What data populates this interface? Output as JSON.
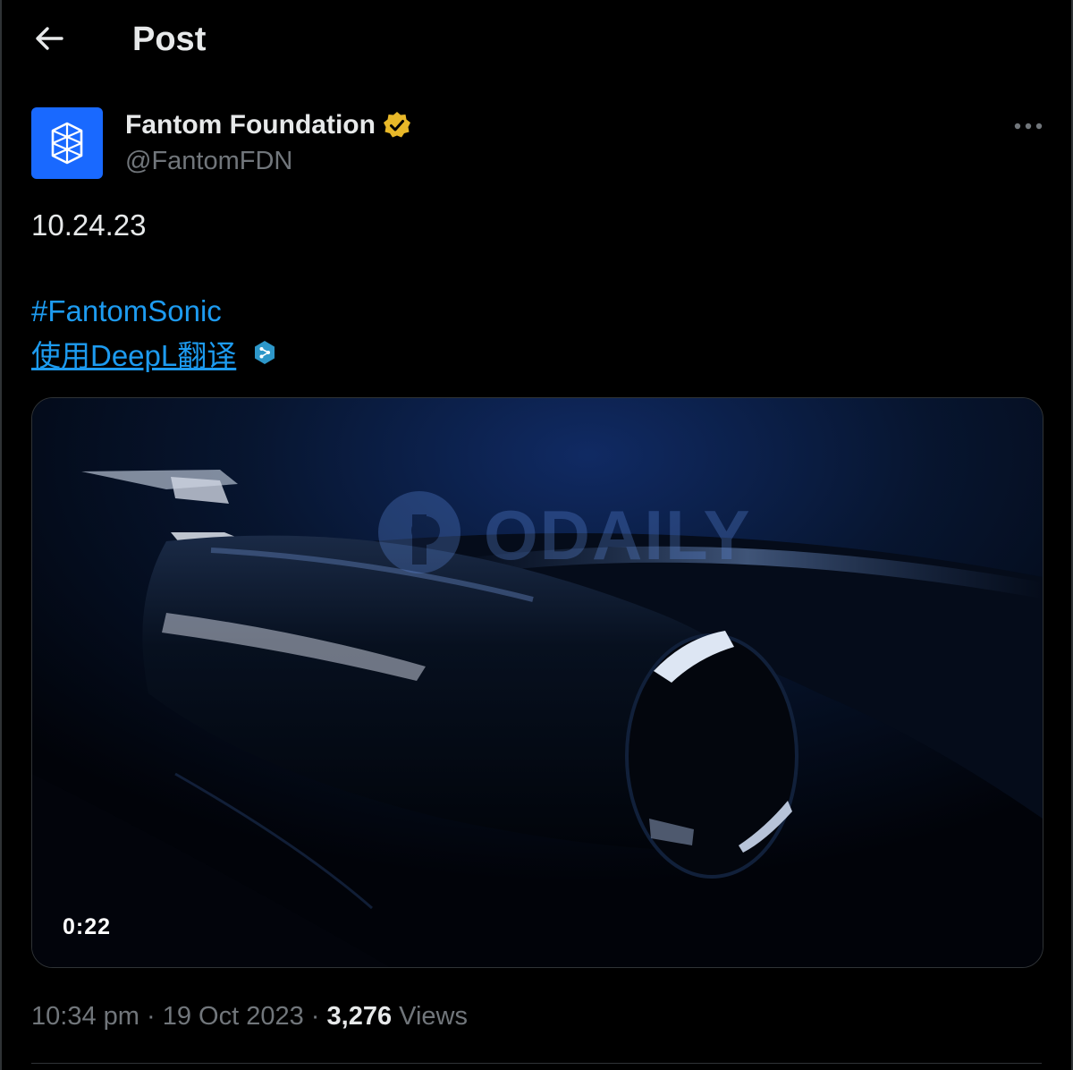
{
  "header": {
    "title": "Post",
    "back_icon": "arrow-left-icon"
  },
  "author": {
    "name": "Fantom Foundation",
    "handle": "@FantomFDN",
    "avatar_icon": "fantom-logo-icon",
    "verified_icon": "verified-badge-icon",
    "avatar_color": "#1969ff",
    "verified_color": "#e8b829"
  },
  "post": {
    "text": "10.24.23",
    "hashtag": "#FantomSonic",
    "translate_label": "使用DeepL翻译",
    "translate_icon": "deepl-icon"
  },
  "media": {
    "duration": "0:22",
    "watermark": "ODAILY"
  },
  "meta": {
    "time": "10:34 pm",
    "date": "19 Oct 2023",
    "separator": "·",
    "views_count": "3,276",
    "views_label": "Views"
  },
  "colors": {
    "link": "#1d9bf0",
    "muted": "#71767b",
    "text": "#e7e9ea"
  }
}
